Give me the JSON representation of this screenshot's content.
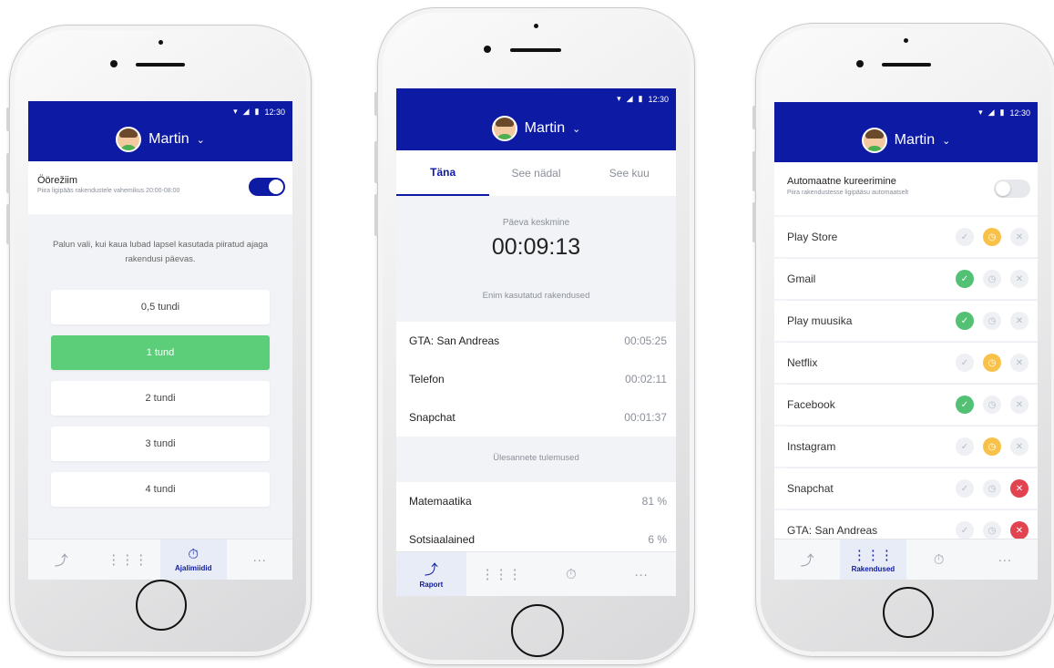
{
  "colors": {
    "primary": "#0d1aa3",
    "selected": "#5ccd79",
    "ok": "#52c174",
    "timer": "#f8c24a",
    "blocked": "#e14350"
  },
  "status_time": "12:30",
  "profile": {
    "name": "Martin",
    "chevron": "chevron-down-icon"
  },
  "screen1": {
    "night_mode": {
      "title": "Öörežiim",
      "subtitle": "Piira ligipääs rakendustele vahemikus 20:00-08:00",
      "enabled": true
    },
    "prompt": "Palun vali, kui kaua lubad lapsel kasutada piiratud ajaga rakendusi päevas.",
    "options": [
      "0,5 tundi",
      "1 tund",
      "2 tundi",
      "3 tundi",
      "4 tundi"
    ],
    "selected_index": 1,
    "tabs": [
      {
        "icon": "trend-icon",
        "glyph": "⤴",
        "label": ""
      },
      {
        "icon": "apps-grid-icon",
        "glyph": "⋮⋮⋮",
        "label": ""
      },
      {
        "icon": "stopwatch-icon",
        "glyph": "⏱",
        "label": "Ajalimiidid"
      },
      {
        "icon": "more-icon",
        "glyph": "···",
        "label": ""
      }
    ]
  },
  "screen2": {
    "tabs": [
      "Täna",
      "See nädal",
      "See kuu"
    ],
    "average_label": "Päeva keskmine",
    "average_value": "00:09:13",
    "most_used_label": "Enim kasutatud rakendused",
    "apps": [
      {
        "name": "GTA: San Andreas",
        "time": "00:05:25"
      },
      {
        "name": "Telefon",
        "time": "00:02:11"
      },
      {
        "name": "Snapchat",
        "time": "00:01:37"
      }
    ],
    "tasks_label": "Ülesannete tulemused",
    "tasks": [
      {
        "name": "Matemaatika",
        "value": "81 %"
      },
      {
        "name": "Sotsiaalained",
        "value": "6 %"
      }
    ],
    "nav": [
      {
        "icon": "trend-icon",
        "glyph": "⤴",
        "label": "Raport"
      },
      {
        "icon": "apps-grid-icon",
        "glyph": "⋮⋮⋮",
        "label": ""
      },
      {
        "icon": "stopwatch-icon",
        "glyph": "⏱",
        "label": ""
      },
      {
        "icon": "more-icon",
        "glyph": "···",
        "label": ""
      }
    ]
  },
  "screen3": {
    "auto": {
      "title": "Automaatne kureerimine",
      "subtitle": "Piira rakendustesse ligipääsu automaatselt",
      "enabled": false
    },
    "apps": [
      {
        "name": "Play Store",
        "state": "timer"
      },
      {
        "name": "Gmail",
        "state": "allowed"
      },
      {
        "name": "Play muusika",
        "state": "allowed"
      },
      {
        "name": "Netflix",
        "state": "timer"
      },
      {
        "name": "Facebook",
        "state": "allowed"
      },
      {
        "name": "Instagram",
        "state": "timer"
      },
      {
        "name": "Snapchat",
        "state": "blocked"
      },
      {
        "name": "GTA: San Andreas",
        "state": "blocked"
      }
    ],
    "nav": [
      {
        "icon": "trend-icon",
        "glyph": "⤴",
        "label": ""
      },
      {
        "icon": "apps-grid-icon",
        "glyph": "⋮⋮⋮",
        "label": "Rakendused"
      },
      {
        "icon": "stopwatch-icon",
        "glyph": "⏱",
        "label": ""
      },
      {
        "icon": "more-icon",
        "glyph": "···",
        "label": ""
      }
    ]
  }
}
